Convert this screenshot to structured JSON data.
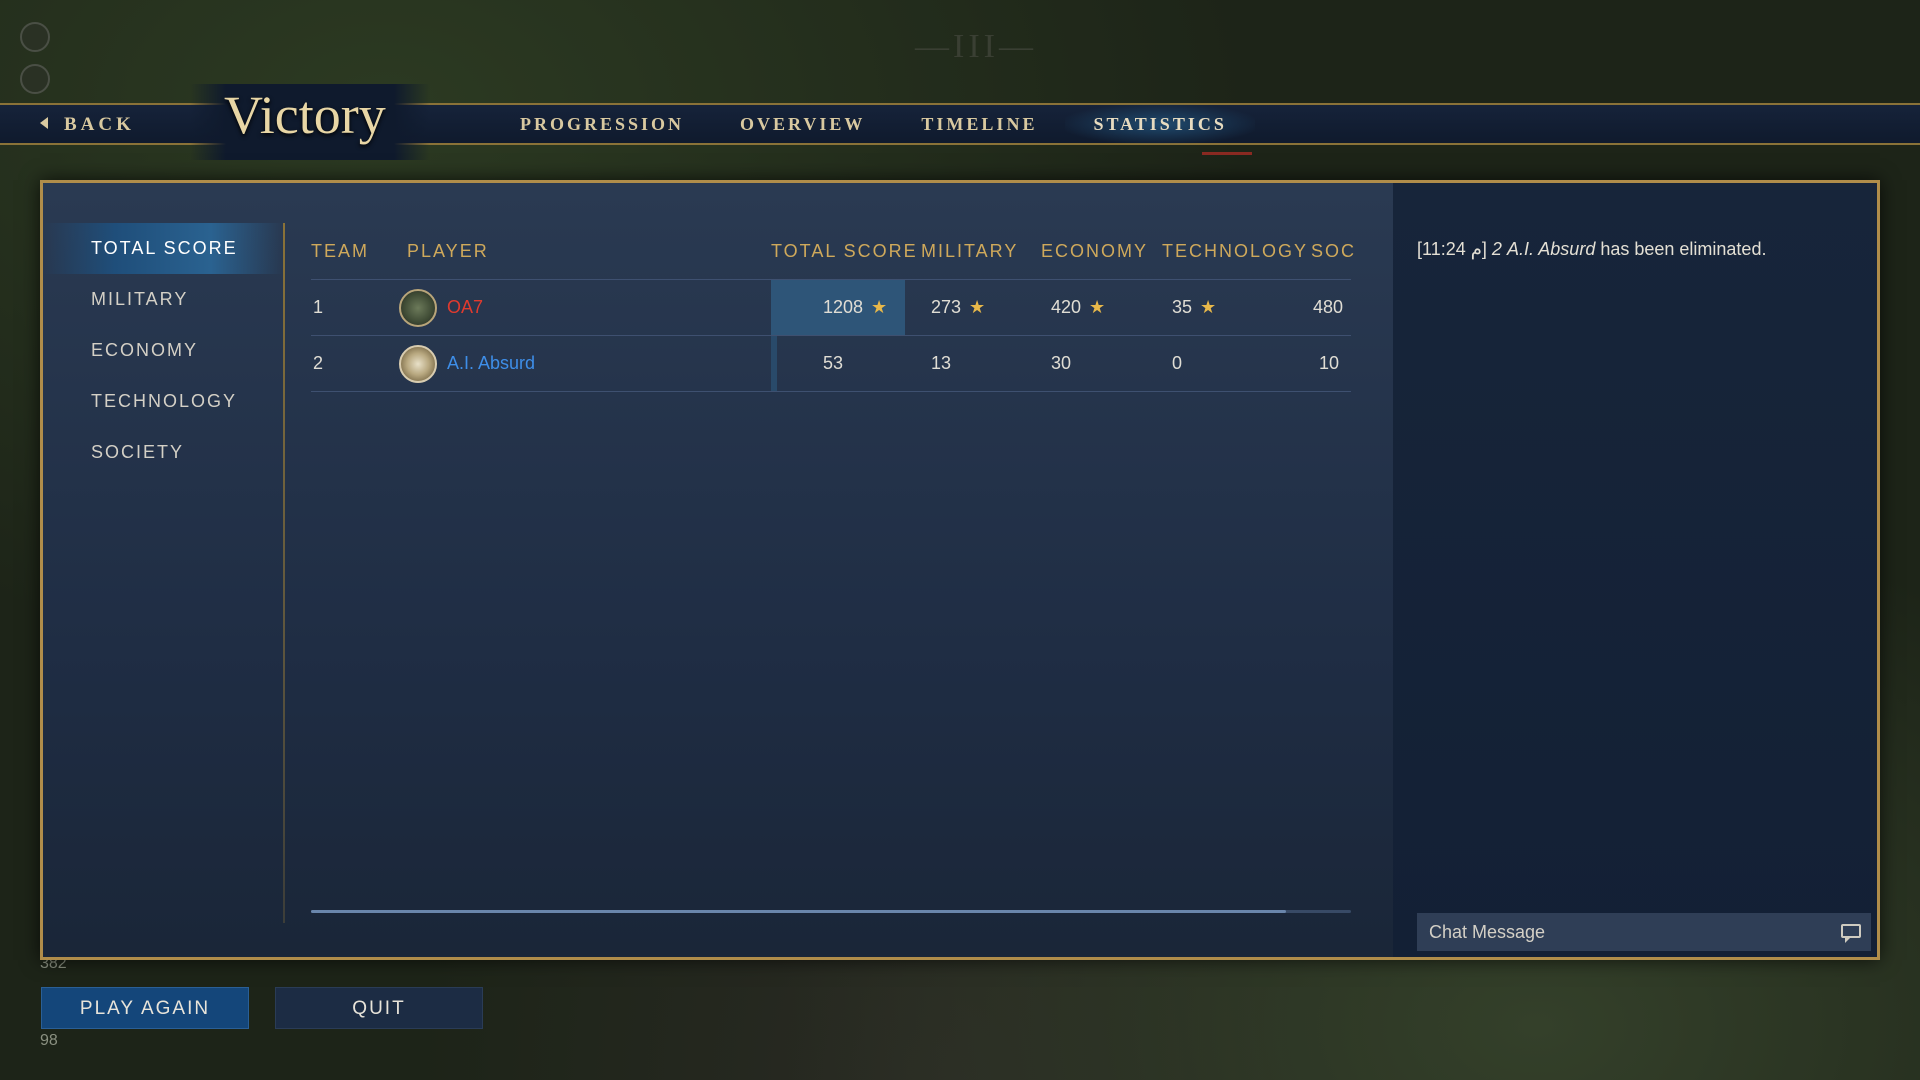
{
  "background": {
    "roman_numeral": "—III—",
    "hud_values": [
      "382",
      "98"
    ]
  },
  "topbar": {
    "back_label": "BACK",
    "title": "Victory",
    "tabs": [
      {
        "label": "PROGRESSION",
        "active": false
      },
      {
        "label": "OVERVIEW",
        "active": false
      },
      {
        "label": "TIMELINE",
        "active": false
      },
      {
        "label": "STATISTICS",
        "active": true
      }
    ]
  },
  "sidebar": {
    "items": [
      {
        "label": "TOTAL SCORE",
        "active": true
      },
      {
        "label": "MILITARY",
        "active": false
      },
      {
        "label": "ECONOMY",
        "active": false
      },
      {
        "label": "TECHNOLOGY",
        "active": false
      },
      {
        "label": "SOCIETY",
        "active": false
      }
    ]
  },
  "table": {
    "headers": {
      "team": "TEAM",
      "player": "PLAYER",
      "total_score": "TOTAL SCORE",
      "military": "MILITARY",
      "economy": "ECONOMY",
      "technology": "TECHNOLOGY",
      "society": "SOC"
    },
    "rows": [
      {
        "team": "1",
        "player": "OA7",
        "player_color": "#e03a2e",
        "total_score": "1208",
        "military": "273",
        "economy": "420",
        "technology": "35",
        "society": "480",
        "stars": [
          "total_score",
          "military",
          "economy",
          "technology"
        ]
      },
      {
        "team": "2",
        "player": "A.I. Absurd",
        "player_color": "#3e8ee8",
        "total_score": "53",
        "military": "13",
        "economy": "30",
        "technology": "0",
        "society": "10",
        "stars": []
      }
    ]
  },
  "chat": {
    "log": [
      {
        "time": "[م 11:24]",
        "team": "2",
        "player": "A.I. Absurd",
        "message": "has been eliminated."
      }
    ],
    "input_placeholder": "Chat Message"
  },
  "buttons": {
    "play_again": "PLAY AGAIN",
    "quit": "QUIT"
  },
  "colors": {
    "accent_gold": "#b08d4a",
    "header_gold": "#cfa95b",
    "active_blue": "#2a6290",
    "player1": "#e03a2e",
    "player2": "#3e8ee8"
  }
}
